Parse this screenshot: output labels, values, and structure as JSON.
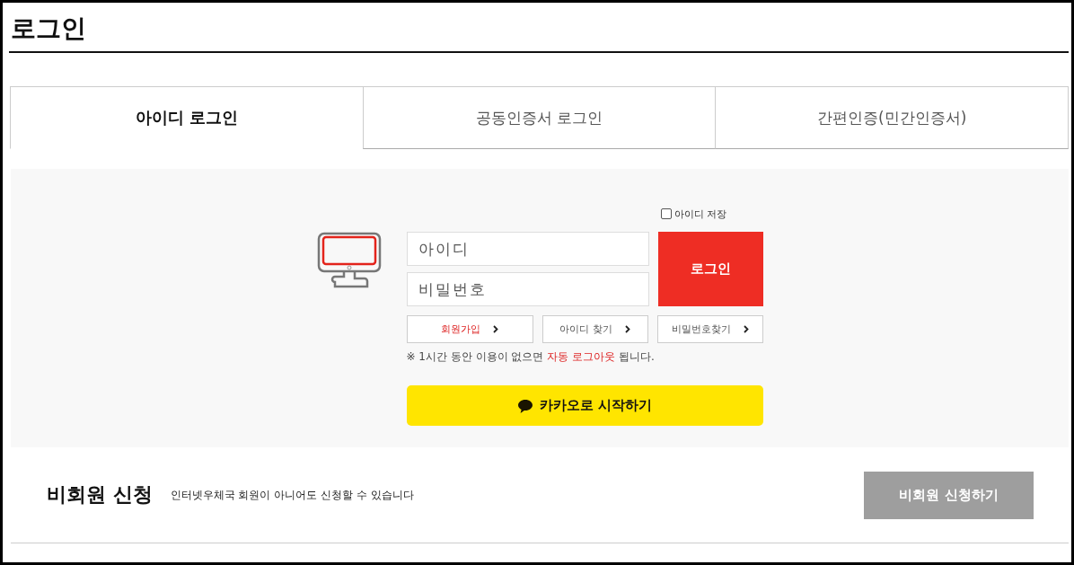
{
  "page_title": "로그인",
  "tabs": [
    {
      "label": "아이디 로그인",
      "selected": true
    },
    {
      "label": "공동인증서 로그인",
      "selected": false
    },
    {
      "label": "간편인증(민간인증서)",
      "selected": false
    }
  ],
  "login": {
    "save_id": {
      "label": "아이디 저장",
      "checked": false
    },
    "id_field": {
      "placeholder": "아이디"
    },
    "password_field": {
      "placeholder": "비밀번호"
    },
    "login_button": "로그인",
    "links": [
      {
        "label": "회원가입",
        "highlight": true
      },
      {
        "label": "아이디 찾기",
        "highlight": false
      },
      {
        "label": "비밀번호찾기",
        "highlight": false
      }
    ],
    "note": [
      {
        "text": "※ 1시간 동안 이용이 없으면 ",
        "highlight": false
      },
      {
        "text": "자동 로그아웃",
        "highlight": true
      },
      {
        "text": " 됩니다.",
        "highlight": false
      }
    ],
    "kakao_button": "카카오로 시작하기"
  },
  "guest": {
    "title": "비회원 신청",
    "description": "인터넷우체국 회원이 아니어도 신청할 수 있습니다",
    "button": "비회원 신청하기"
  }
}
